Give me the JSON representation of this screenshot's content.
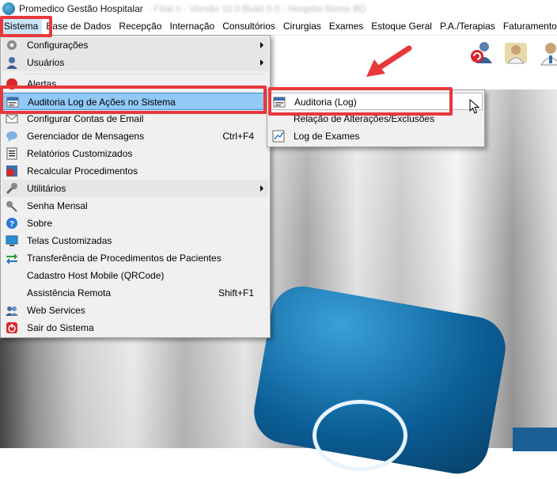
{
  "window": {
    "title": "Promedico Gestão Hospitalar",
    "title_blurred": "- Filial n - Versão 10.0 Build 0.0 - Hospital Nome BD"
  },
  "menubar": {
    "items": [
      "Sistema",
      "Base de Dados",
      "Recepção",
      "Internação",
      "Consultórios",
      "Cirurgias",
      "Exames",
      "Estoque Geral",
      "P.A./Terapias",
      "Faturamento"
    ]
  },
  "toolbar": {
    "icons": [
      "refresh-users-icon",
      "doctor-group-icon",
      "doctor-icon"
    ]
  },
  "sistema_menu": {
    "items": [
      {
        "label": "Configurações",
        "icon": "gear-icon",
        "submenu": true
      },
      {
        "label": "Usuários",
        "icon": "user-icon",
        "submenu": true
      },
      {
        "label": "Alertas",
        "icon": "alert-icon",
        "submenu": false
      },
      {
        "label": "Auditoria Log de Ações no Sistema",
        "icon": "sys-log-icon",
        "submenu": false
      },
      {
        "label": "Configurar Contas de Email",
        "icon": "email-icon",
        "submenu": false
      },
      {
        "label": "Gerenciador de Mensagens",
        "shortcut": "Ctrl+F4",
        "icon": "message-icon"
      },
      {
        "label": "Relatórios Customizados",
        "icon": "report-icon"
      },
      {
        "label": "Recalcular Procedimentos",
        "icon": "recalc-icon"
      },
      {
        "label": "Utilitários",
        "icon": "wrench-icon",
        "submenu": true
      },
      {
        "label": "Senha Mensal",
        "icon": "key-icon"
      },
      {
        "label": "Sobre",
        "icon": "help-icon"
      },
      {
        "label": "Telas Customizadas",
        "icon": "screen-icon"
      },
      {
        "label": "Transferência de Procedimentos de Pacientes",
        "icon": "transfer-icon"
      },
      {
        "label": "Cadastro Host Mobile (QRCode)",
        "icon": ""
      },
      {
        "label": "Assistência Remota",
        "shortcut": "Shift+F1",
        "icon": ""
      },
      {
        "label": "Web Services",
        "icon": "web-services-icon"
      },
      {
        "label": "Sair do Sistema",
        "icon": "exit-icon"
      }
    ]
  },
  "auditoria_submenu": {
    "items": [
      {
        "label": "Auditoria (Log)",
        "icon": "sys-log-icon"
      },
      {
        "label": "Relação de Alterações/Exclusões",
        "icon": ""
      },
      {
        "label": "Log de Exames",
        "icon": "chart-icon"
      }
    ]
  },
  "colors": {
    "highlight": "#91c9f7",
    "annotation_red": "#e8383c",
    "menu_bg": "#f0f0f0"
  }
}
